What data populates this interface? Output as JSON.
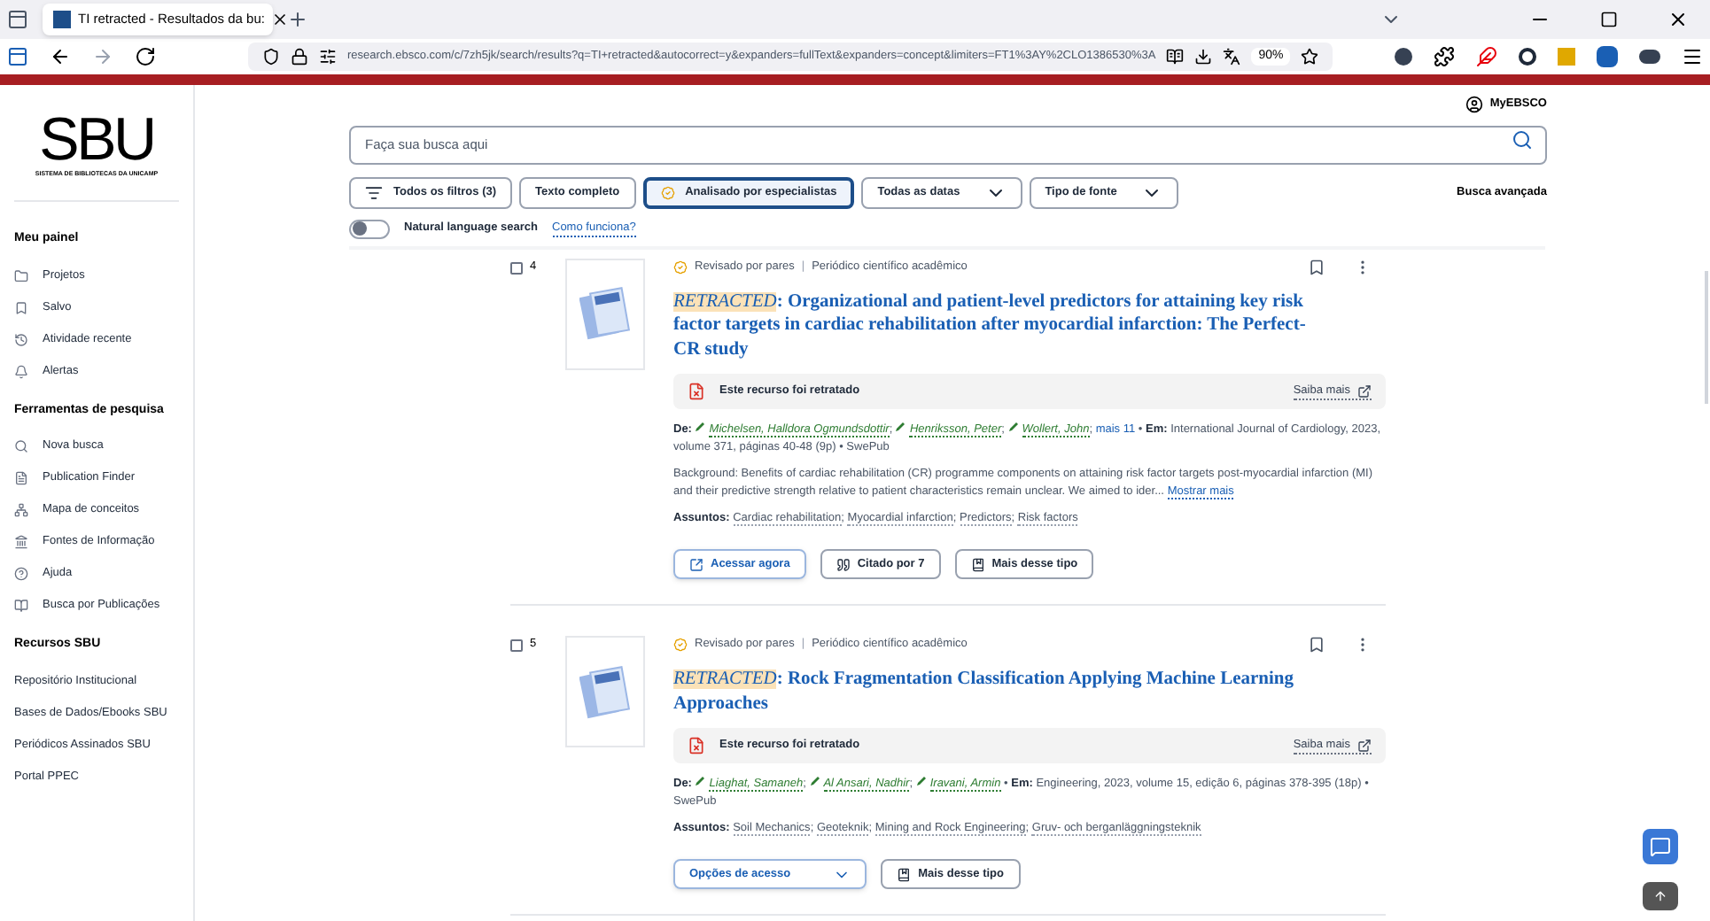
{
  "browser": {
    "tab_title": "TI retracted - Resultados da bu:",
    "url": "research.ebsco.com/c/7zh5jk/search/results?q=TI+retracted&autocorrect=y&expanders=fullText&expanders=concept&limiters=FT1%3AY%2CLO1386530%3A",
    "zoom": "90%"
  },
  "sidebar": {
    "logo": "SBU",
    "logo_caption": "SISTEMA DE BIBLIOTECAS DA UNICAMP",
    "sections": [
      {
        "title": "Meu painel",
        "items": [
          {
            "label": "Projetos"
          },
          {
            "label": "Salvo"
          },
          {
            "label": "Atividade recente"
          },
          {
            "label": "Alertas"
          }
        ]
      },
      {
        "title": "Ferramentas de pesquisa",
        "items": [
          {
            "label": "Nova busca"
          },
          {
            "label": "Publication Finder"
          },
          {
            "label": "Mapa de conceitos"
          },
          {
            "label": "Fontes de Informação"
          },
          {
            "label": "Ajuda"
          },
          {
            "label": "Busca por Publicações"
          }
        ]
      },
      {
        "title": "Recursos SBU",
        "items": [
          {
            "label": "Repositório Institucional"
          },
          {
            "label": "Bases de Dados/Ebooks SBU"
          },
          {
            "label": "Periódicos Assinados SBU"
          },
          {
            "label": "Portal PPEC"
          }
        ]
      }
    ]
  },
  "account": "MyEBSCO",
  "search": {
    "placeholder": "Faça sua busca aqui"
  },
  "filters": [
    {
      "label": "Todos os filtros (3)",
      "kind": "filters",
      "selected": false
    },
    {
      "label": "Texto completo",
      "kind": "chip",
      "selected": false
    },
    {
      "label": "Analisado por especialistas",
      "kind": "chip",
      "selected": true
    },
    {
      "label": "Todas as datas",
      "kind": "dropdown",
      "selected": false
    },
    {
      "label": "Tipo de fonte",
      "kind": "dropdown",
      "selected": false
    }
  ],
  "advanced_search": "Busca avançada",
  "natural_language": {
    "label": "Natural language search",
    "on": false,
    "help_link": "Como funciona?"
  },
  "results": [
    {
      "number": "4",
      "checked": false,
      "peer_reviewed": "Revisado por pares",
      "divider": "|",
      "author_separator": ";",
      "bullet": "•",
      "type": "Periódico científico acadêmico",
      "flag": "RETRACTED",
      "title": ": Organizational and patient-level predictors for attaining key risk factor targets in cardiac rehabilitation after myocardial infarction: The Perfect-CR study",
      "notice": "Este recurso foi retratado",
      "notice_link": "Saiba mais",
      "by_label": "De:",
      "authors": [
        "Michelsen, Halldora Ogmundsdottir",
        "Henriksson, Peter",
        "Wollert, John"
      ],
      "more_authors": "mais 11",
      "in_label": "Em:",
      "source": "International Journal of Cardiology, 2023, volume 371, páginas 40-48 (9p) • SwePub",
      "abstract": "Background: Benefits of cardiac rehabilitation (CR) programme components on attaining risk factor targets post-myocardial infarction (MI) and their predictive strength relative to patient characteristics remain unclear. We aimed to ider...",
      "show_more": "Mostrar mais",
      "subjects_label": "Assuntos:",
      "subjects": [
        "Cardiac rehabilitation",
        "Myocardial infarction",
        "Predictors",
        "Risk factors"
      ],
      "actions": [
        {
          "label": "Acessar agora",
          "kind": "primary"
        },
        {
          "label": "Citado por 7",
          "kind": "cited"
        },
        {
          "label": "Mais desse tipo",
          "kind": "more"
        }
      ]
    },
    {
      "number": "5",
      "checked": false,
      "peer_reviewed": "Revisado por pares",
      "divider": "|",
      "author_separator": ";",
      "bullet": "•",
      "type": "Periódico científico acadêmico",
      "flag": "RETRACTED",
      "title": ": Rock Fragmentation Classification Applying Machine Learning Approaches",
      "notice": "Este recurso foi retratado",
      "notice_link": "Saiba mais",
      "by_label": "De:",
      "authors": [
        "Liaghat, Samaneh",
        "Al Ansari, Nadhir",
        "Iravani, Armin"
      ],
      "in_label": "Em:",
      "source": "Engineering, 2023, volume 15, edição 6, páginas 378-395 (18p) • SwePub",
      "subjects_label": "Assuntos:",
      "subjects": [
        "Soil Mechanics",
        "Geoteknik",
        "Mining and Rock Engineering",
        "Gruv- och berganläggningsteknik"
      ],
      "actions": [
        {
          "label": "Opções de acesso",
          "kind": "dropdown"
        },
        {
          "label": "Mais desse tipo",
          "kind": "more"
        }
      ]
    }
  ]
}
